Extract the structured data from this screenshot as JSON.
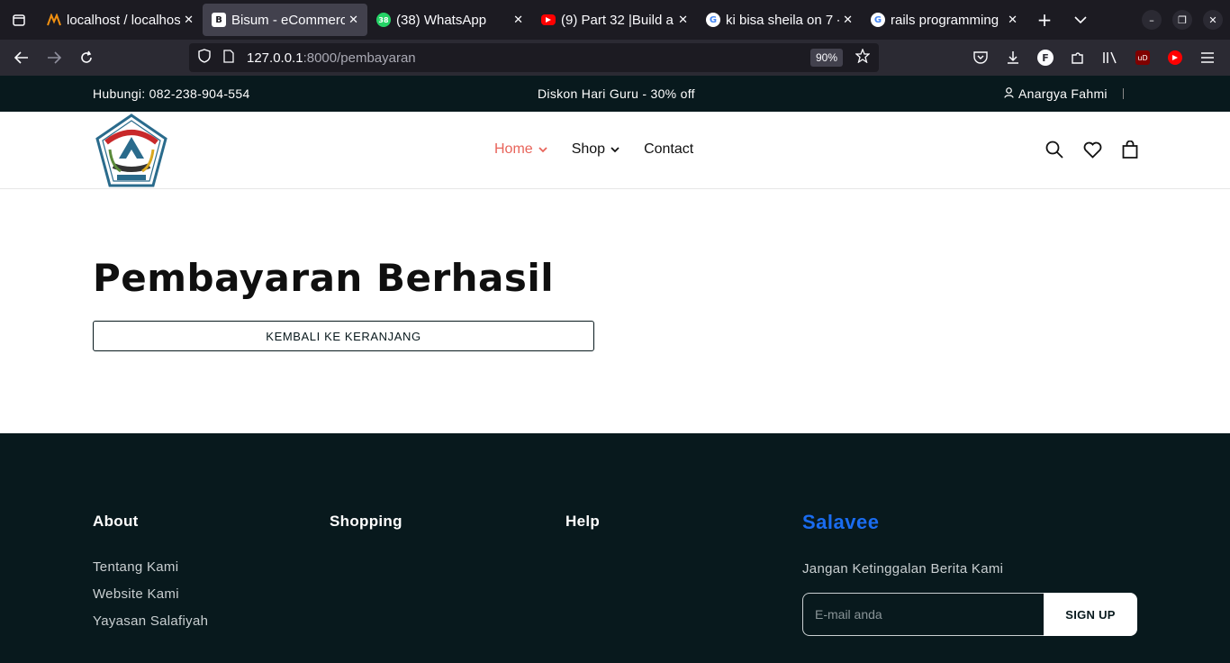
{
  "browser": {
    "tabs": [
      {
        "title": "localhost / localhost",
        "active": false,
        "icon": "phpmyadmin-icon"
      },
      {
        "title": "Bisum - eCommerce",
        "active": true,
        "icon": "bootstrap-icon"
      },
      {
        "title": "(38) WhatsApp",
        "active": false,
        "icon": "whatsapp-icon"
      },
      {
        "title": "(9) Part 32 |Build a",
        "active": false,
        "icon": "youtube-icon"
      },
      {
        "title": "ki bisa sheila on 7 -",
        "active": false,
        "icon": "google-icon"
      },
      {
        "title": "rails programming",
        "active": false,
        "icon": "google-icon"
      }
    ],
    "url_host": "127.0.0.1",
    "url_path": ":8000/pembayaran",
    "zoom": "90%"
  },
  "topbar": {
    "contact": "Hubungi: 082-238-904-554",
    "promo": "Diskon Hari Guru - 30% off",
    "user": "Anargya Fahmi"
  },
  "menu": {
    "home": "Home",
    "shop": "Shop",
    "contact": "Contact"
  },
  "main": {
    "title": "Pembayaran Berhasil",
    "back_button": "KEMBALI KE KERANJANG"
  },
  "footer": {
    "about_title": "About",
    "shopping_title": "Shopping",
    "help_title": "Help",
    "about_links": [
      "Tentang Kami",
      "Website Kami",
      "Yayasan Salafiyah"
    ],
    "brand": "Salavee",
    "newsletter_text": "Jangan Ketinggalan Berita Kami",
    "email_placeholder": "E-mail anda",
    "signup": "SIGN UP"
  },
  "colors": {
    "dark": "#08191d",
    "accent": "#e8645a",
    "brand": "#1a6cf0"
  }
}
